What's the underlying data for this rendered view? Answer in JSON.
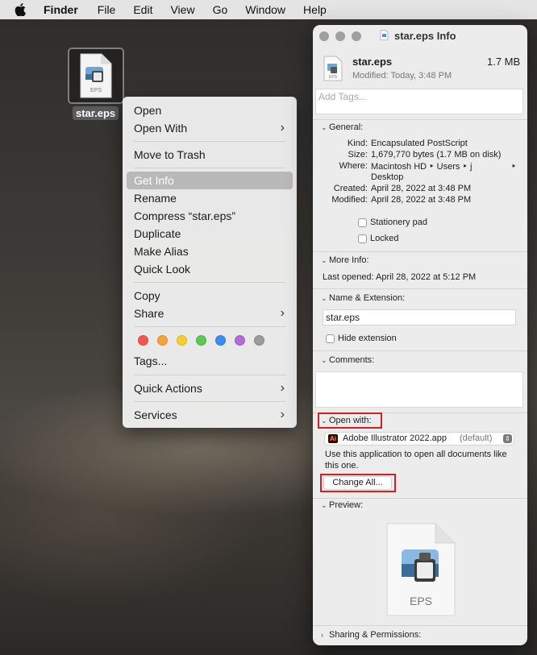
{
  "menubar": {
    "app": "Finder",
    "items": [
      "File",
      "Edit",
      "View",
      "Go",
      "Window",
      "Help"
    ]
  },
  "desktop": {
    "file_label": "star.eps",
    "icon_badge": "EPS"
  },
  "context_menu": {
    "open": "Open",
    "open_with": "Open With",
    "move_to_trash": "Move to Trash",
    "get_info": "Get Info",
    "rename": "Rename",
    "compress": "Compress “star.eps”",
    "duplicate": "Duplicate",
    "make_alias": "Make Alias",
    "quick_look": "Quick Look",
    "copy": "Copy",
    "share": "Share",
    "tags": "Tags...",
    "quick_actions": "Quick Actions",
    "services": "Services",
    "tag_colors": [
      "#f0584f",
      "#f6a33a",
      "#f5cf2e",
      "#5bc84f",
      "#3a8ef0",
      "#b26ad9",
      "#9b9b9b"
    ]
  },
  "info": {
    "title": "star.eps Info",
    "file_name": "star.eps",
    "file_size": "1.7 MB",
    "modified_short": "Modified: Today, 3:48 PM",
    "tags_placeholder": "Add Tags...",
    "general": {
      "header": "General:",
      "kind_label": "Kind:",
      "kind": "Encapsulated PostScript",
      "size_label": "Size:",
      "size": "1,679,770 bytes (1.7 MB on disk)",
      "where_label": "Where:",
      "where": "Macintosh HD ‣ Users ‣ j",
      "where_arrow": "‣",
      "where_cont": "Desktop",
      "created_label": "Created:",
      "created": "April 28, 2022 at 3:48 PM",
      "modified_label": "Modified:",
      "modified": "April 28, 2022 at 3:48 PM",
      "stationery": "Stationery pad",
      "locked": "Locked"
    },
    "more_info": {
      "header": "More Info:",
      "last_opened": "Last opened: April 28, 2022 at 5:12 PM"
    },
    "name_ext": {
      "header": "Name & Extension:",
      "value": "star.eps",
      "hide_extension": "Hide extension"
    },
    "comments": {
      "header": "Comments:"
    },
    "open_with": {
      "header": "Open with:",
      "app_badge": "Ai",
      "app": "Adobe Illustrator 2022.app",
      "default": "(default)",
      "description": "Use this application to open all documents like this one.",
      "change_all": "Change All..."
    },
    "preview": {
      "header": "Preview:",
      "badge": "EPS"
    },
    "sharing": {
      "header": "Sharing & Permissions:"
    }
  },
  "colors": {
    "highlight": "#d0201f",
    "menu_selection": "#b9b9b9",
    "illustrator": "#330000"
  }
}
